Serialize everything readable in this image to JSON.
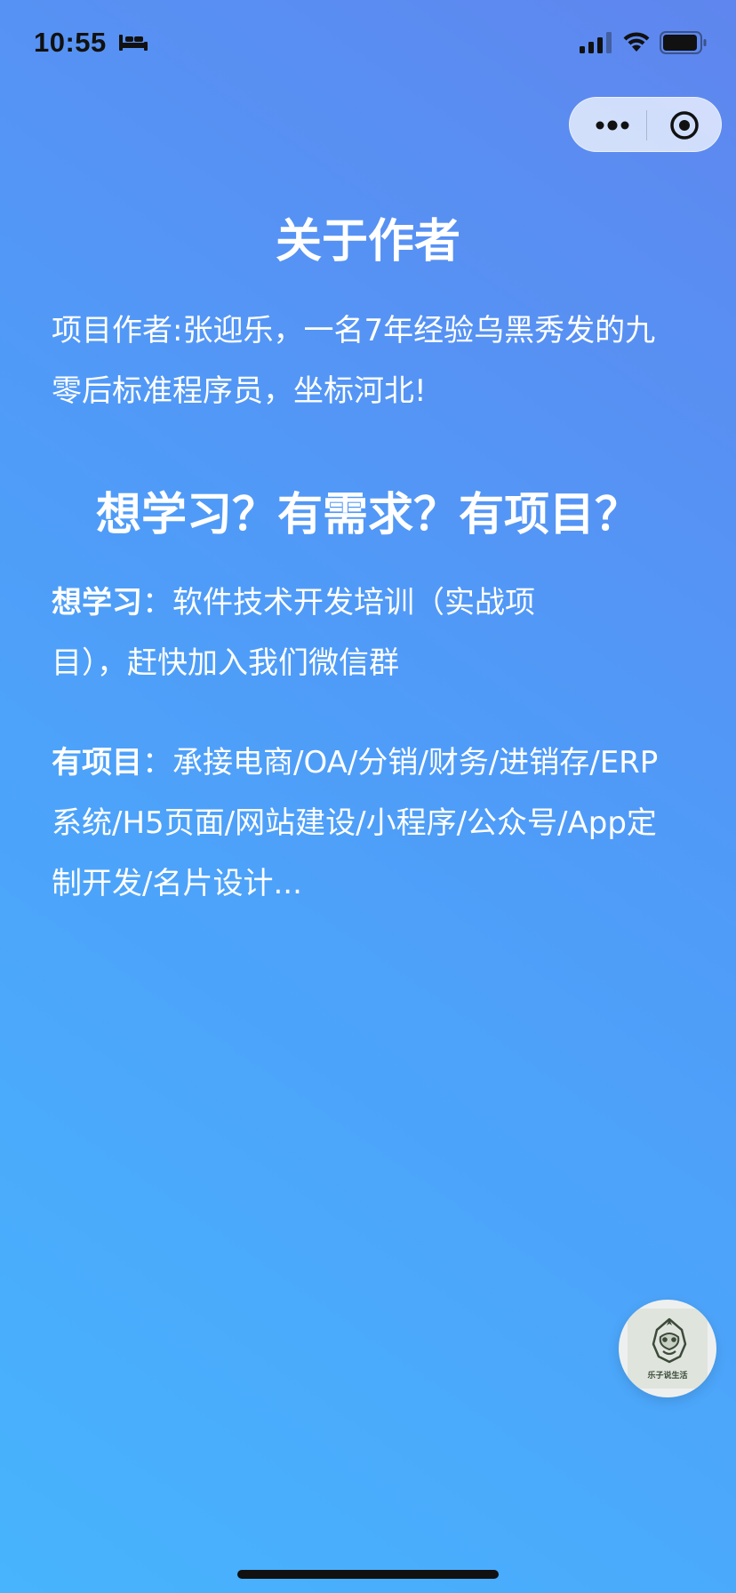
{
  "status_bar": {
    "time": "10:55",
    "icons": [
      "sleep-mode-icon",
      "cellular-signal-icon",
      "wifi-icon",
      "battery-icon"
    ]
  },
  "capsule": {
    "icons": [
      "more-dots-icon",
      "close-target-icon"
    ]
  },
  "about": {
    "title": "关于作者",
    "intro": "项目作者:张迎乐，一名7年经验乌黑秀发的九零后标准程序员，坐标河北!"
  },
  "want": {
    "title": "想学习？有需求？有项目？",
    "learn_label": "想学习",
    "learn_colon": "：",
    "learn_text": "软件技术开发培训（实战项目），赶快加入我们微信群",
    "project_label": "有项目",
    "project_colon": "：",
    "project_text": "承接电商/OA/分销/财务/进销存/ERP系统/H5页面/网站建设/小程序/公众号/App定制开发/名片设计..."
  },
  "float_avatar": {
    "caption": "乐子说生活"
  },
  "colors": {
    "gradient_top": "#5f86ee",
    "gradient_bottom": "#47b4fd",
    "text": "#ffffff"
  }
}
